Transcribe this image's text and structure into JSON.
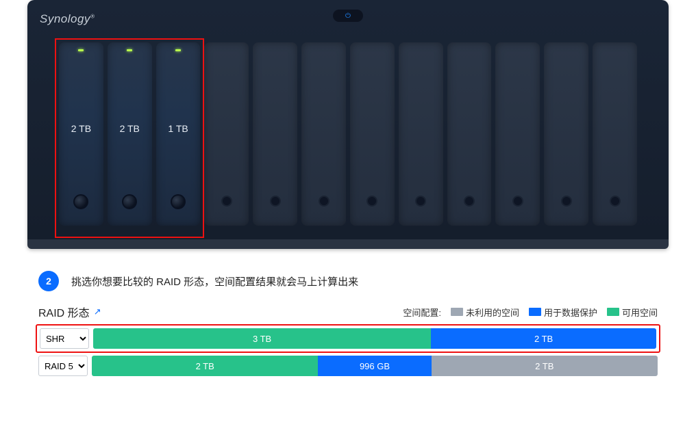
{
  "brand": "Synology",
  "bays": [
    {
      "filled": true,
      "capacity": "2 TB"
    },
    {
      "filled": true,
      "capacity": "2 TB"
    },
    {
      "filled": true,
      "capacity": "1 TB"
    },
    {
      "filled": false,
      "capacity": ""
    },
    {
      "filled": false,
      "capacity": ""
    },
    {
      "filled": false,
      "capacity": ""
    },
    {
      "filled": false,
      "capacity": ""
    },
    {
      "filled": false,
      "capacity": ""
    },
    {
      "filled": false,
      "capacity": ""
    },
    {
      "filled": false,
      "capacity": ""
    },
    {
      "filled": false,
      "capacity": ""
    },
    {
      "filled": false,
      "capacity": ""
    }
  ],
  "step": {
    "num": "2",
    "text": "挑选你想要比较的 RAID 形态，空间配置结果就会马上计算出来"
  },
  "result": {
    "title": "RAID 形态",
    "legend_label": "空间配置:",
    "legend": {
      "unused": "未利用的空间",
      "protect": "用于数据保护",
      "avail": "可用空间"
    },
    "rows": [
      {
        "type": "SHR",
        "highlight": true,
        "segments": [
          {
            "kind": "avail",
            "label": "3 TB",
            "pct": 60
          },
          {
            "kind": "protect",
            "label": "2 TB",
            "pct": 40
          }
        ]
      },
      {
        "type": "RAID 5",
        "highlight": false,
        "segments": [
          {
            "kind": "avail",
            "label": "2 TB",
            "pct": 40
          },
          {
            "kind": "protect",
            "label": "996 GB",
            "pct": 20
          },
          {
            "kind": "unused",
            "label": "2 TB",
            "pct": 40
          }
        ]
      }
    ]
  }
}
